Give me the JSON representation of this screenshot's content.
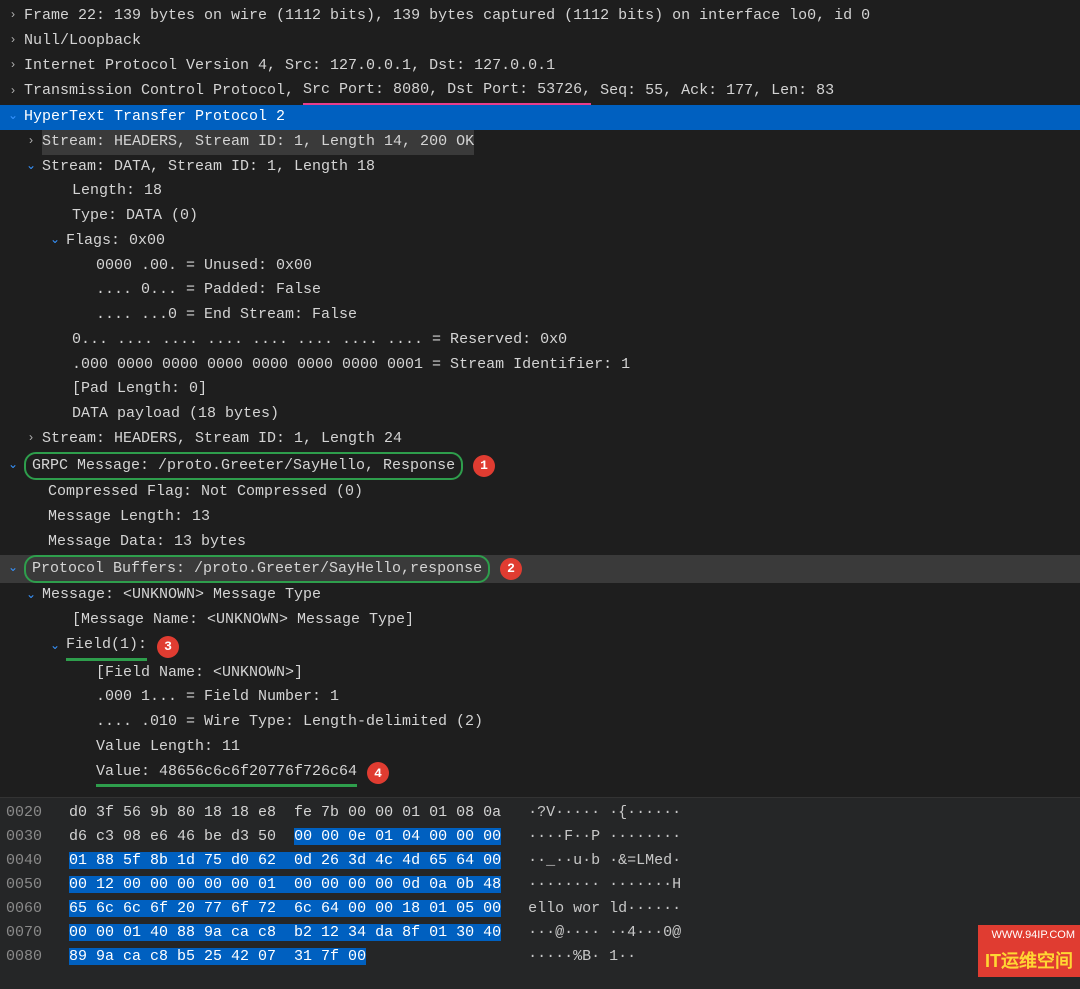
{
  "tree": {
    "frame": "Frame 22: 139 bytes on wire (1112 bits), 139 bytes captured (1112 bits) on interface lo0, id 0",
    "null_loop": "Null/Loopback",
    "ip": "Internet Protocol Version 4, Src: 127.0.0.1, Dst: 127.0.0.1",
    "tcp_prefix": "Transmission Control Protocol, ",
    "tcp_ports": "Src Port: 8080, Dst Port: 53726,",
    "tcp_suffix": " Seq: 55, Ack: 177, Len: 83",
    "http2": "HyperText Transfer Protocol 2",
    "stream_headers": "Stream: HEADERS, Stream ID: 1, Length 14, 200 OK",
    "stream_data": "Stream: DATA, Stream ID: 1, Length 18",
    "length": "Length: 18",
    "type": "Type: DATA (0)",
    "flags": "Flags: 0x00",
    "unused": "0000 .00. = Unused: 0x00",
    "padded": ".... 0... = Padded: False",
    "end_stream": ".... ...0 = End Stream: False",
    "reserved": "0... .... .... .... .... .... .... .... = Reserved: 0x0",
    "stream_id": ".000 0000 0000 0000 0000 0000 0000 0001 = Stream Identifier: 1",
    "pad_len": "[Pad Length: 0]",
    "payload": "DATA payload (18 bytes)",
    "stream_headers2": "Stream: HEADERS, Stream ID: 1, Length 24",
    "grpc": "GRPC Message: /proto.Greeter/SayHello, Response",
    "compressed": "Compressed Flag: Not Compressed (0)",
    "msg_len": "Message Length: 13",
    "msg_data": "Message Data: 13 bytes",
    "protobuf": "Protocol Buffers: /proto.Greeter/SayHello,response",
    "message": "Message: <UNKNOWN> Message Type",
    "msg_name": "[Message Name: <UNKNOWN> Message Type]",
    "field1": "Field(1):",
    "field_name": "[Field Name: <UNKNOWN>]",
    "field_num": ".000 1... = Field Number: 1",
    "wire_type": ".... .010 = Wire Type: Length-delimited (2)",
    "val_len": "Value Length: 11",
    "value_label": "Value: ",
    "value_hex": "48656c6c6f20776f726c64"
  },
  "callouts": {
    "c1": "1",
    "c2": "2",
    "c3": "3",
    "c4": "4"
  },
  "hex": {
    "rows": [
      {
        "off": "0020",
        "pre": "d0 3f 56 9b 80 18 18 e8  fe 7b 00 00 01 01 08 0a",
        "sel": "",
        "suf": "   ·?V····· ·{······"
      },
      {
        "off": "0030",
        "pre": "d6 c3 08 e6 46 be d3 50  ",
        "sel": "00 00 0e 01 04 00 00 00",
        "suf": "   ····F··P ········"
      },
      {
        "off": "0040",
        "pre": "",
        "sel": "01 88 5f 8b 1d 75 d0 62  0d 26 3d 4c 4d 65 64 00",
        "suf": "   ··_··u·b ·&=LMed·"
      },
      {
        "off": "0050",
        "pre": "",
        "sel": "00 12 00 00 00 00 00 01  00 00 00 00 0d 0a 0b 48",
        "suf": "   ········ ·······H"
      },
      {
        "off": "0060",
        "pre": "",
        "sel": "65 6c 6c 6f 20 77 6f 72  6c 64 00 00 18 01 05 00",
        "suf": "   ello wor ld······"
      },
      {
        "off": "0070",
        "pre": "",
        "sel": "00 00 01 40 88 9a ca c8  b2 12 34 da 8f 01 30 40",
        "suf": "   ···@···· ··4···0@"
      },
      {
        "off": "0080",
        "pre": "",
        "sel": "89 9a ca c8 b5 25 42 07  31 7f 00",
        "suf": "                  ·····%B· 1··"
      }
    ]
  },
  "watermark": {
    "line1": "WWW.94IP.COM",
    "line2": "IT运维空间"
  }
}
